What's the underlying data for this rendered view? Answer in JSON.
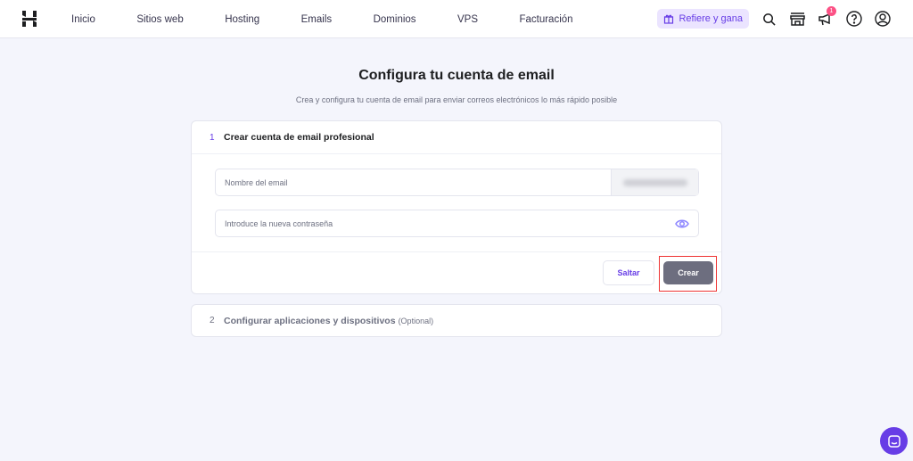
{
  "nav": {
    "items": [
      "Inicio",
      "Sitios web",
      "Hosting",
      "Emails",
      "Dominios",
      "VPS",
      "Facturación"
    ],
    "refer": "Refiere y gana",
    "notification_count": "1"
  },
  "page": {
    "title": "Configura tu cuenta de email",
    "subtitle": "Crea y configura tu cuenta de email para enviar correos electrónicos lo más rápido posible"
  },
  "step1": {
    "number": "1",
    "title": "Crear cuenta de email profesional",
    "email_placeholder": "Nombre del email",
    "password_placeholder": "Introduce la nueva contraseña",
    "skip": "Saltar",
    "create": "Crear"
  },
  "step2": {
    "number": "2",
    "title": "Configurar aplicaciones y dispositivos",
    "optional": "(Optional)"
  },
  "colors": {
    "accent": "#673de6",
    "button": "#6d6e7f"
  }
}
